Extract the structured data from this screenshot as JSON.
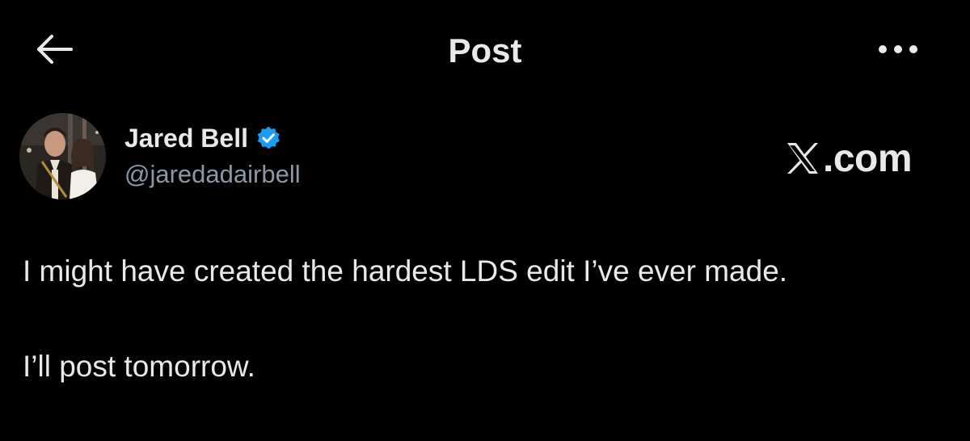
{
  "header": {
    "title": "Post",
    "back_icon": "arrow-left-icon",
    "more_icon": "more-horizontal-icon"
  },
  "author": {
    "display_name": "Jared Bell",
    "handle": "@jaredadairbell",
    "verified": true,
    "verified_color": "#1d9bf0"
  },
  "watermark": {
    "text": ".com",
    "logo": "x-logo-icon"
  },
  "post": {
    "lines": [
      "I might have created the hardest LDS edit I’ve ever made.",
      "I’ll post tomorrow."
    ]
  },
  "colors": {
    "background": "#000000",
    "text_primary": "#e7e9ea",
    "text_secondary": "#8b98a5",
    "accent": "#1d9bf0"
  }
}
